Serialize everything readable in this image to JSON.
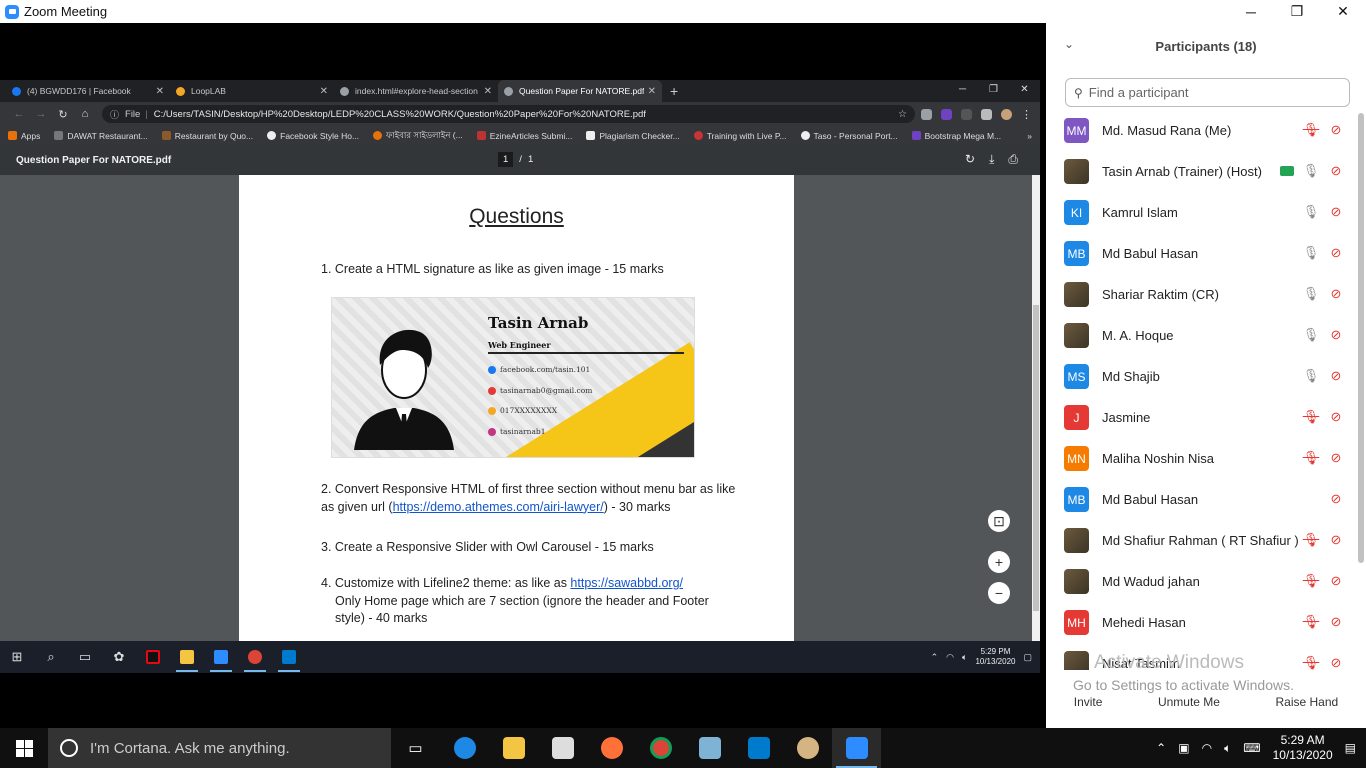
{
  "zoom": {
    "title": "Zoom Meeting",
    "controls": {
      "minimize": "─",
      "restore": "❐",
      "close": "✕"
    }
  },
  "chrome": {
    "tabs": [
      {
        "label": "(4) BGWDD176 | Facebook",
        "color": "#1877f2"
      },
      {
        "label": "LoopLAB",
        "color": "#f5a623"
      },
      {
        "label": "index.html#explore-head-section",
        "color": "#9aa0a6"
      },
      {
        "label": "Question Paper For NATORE.pdf",
        "color": "#9aa0a6"
      }
    ],
    "new_tab": "+",
    "address": {
      "prefix": "File",
      "url": "C:/Users/TASIN/Desktop/HP%20Desktop/LEDP%20CLASS%20WORK/Question%20Paper%20For%20NATORE.pdf"
    },
    "bookmarks": [
      {
        "label": "Apps",
        "color": "#e8710a"
      },
      {
        "label": "DAWAT Restaurant...",
        "color": "#777"
      },
      {
        "label": "Restaurant by Quo...",
        "color": "#8a5a2b"
      },
      {
        "label": "Facebook Style Ho...",
        "color": "#eee"
      },
      {
        "label": "ফাইবার সাইডলাইন (...",
        "color": "#e8710a"
      },
      {
        "label": "EzineArticles Submi...",
        "color": "#b33"
      },
      {
        "label": "Plagiarism Checker...",
        "color": "#eee"
      },
      {
        "label": "Training with Live P...",
        "color": "#c33"
      },
      {
        "label": "Taso - Personal Port...",
        "color": "#eee"
      },
      {
        "label": "Bootstrap Mega M...",
        "color": "#6f42c1"
      }
    ],
    "bookmarks_more": "»"
  },
  "pdf": {
    "title": "Question Paper For NATORE.pdf",
    "page_current": "1",
    "page_sep": "/",
    "page_total": "1",
    "heading": "Questions",
    "q1": "1.   Create a HTML signature as like as given image - 15 marks",
    "q2_a": "2.   Convert  Responsive HTML of first three section without menu bar as like as given url (",
    "q2_link": "https://demo.athemes.com/airi-lawyer/",
    "q2_b": ") - 30 marks",
    "q3": "3.   Create a Responsive Slider with Owl Carousel - 15 marks",
    "q4_a": "4.  Customize with Lifeline2 theme: as like as ",
    "q4_link": "https://sawabbd.org/",
    "q4_b": "Only Home page which are 7 section (ignore the header and Footer style) - 40 marks",
    "signature": {
      "name": "Tasin Arnab",
      "role": "Web Engineer",
      "facebook": "facebook.com/tasin.101",
      "email": "tasinarnab0@gmail.com",
      "phone": "017XXXXXXXX",
      "instagram": "tasinarnab1"
    }
  },
  "inner_clock": {
    "time": "5:29 PM",
    "date": "10/13/2020"
  },
  "participants": {
    "title": "Participants (18)",
    "search_placeholder": "Find a participant",
    "list": [
      {
        "name": "Md. Masud Rana (Me)",
        "initials": "MM",
        "color": "#7e57c2",
        "mic": "muted",
        "photo": false,
        "sharing": false
      },
      {
        "name": "Tasin Arnab (Trainer) (Host)",
        "initials": "",
        "color": "#555",
        "mic": "on",
        "photo": true,
        "sharing": true
      },
      {
        "name": "Kamrul Islam",
        "initials": "KI",
        "color": "#1e88e5",
        "mic": "on",
        "photo": false,
        "sharing": false
      },
      {
        "name": "Md Babul Hasan",
        "initials": "MB",
        "color": "#1e88e5",
        "mic": "on",
        "photo": false,
        "sharing": false
      },
      {
        "name": "Shariar Raktim (CR)",
        "initials": "",
        "color": "#555",
        "mic": "on",
        "photo": true,
        "sharing": false
      },
      {
        "name": "M. A. Hoque",
        "initials": "",
        "color": "#555",
        "mic": "on",
        "photo": true,
        "sharing": false
      },
      {
        "name": "Md Shajib",
        "initials": "MS",
        "color": "#1e88e5",
        "mic": "on",
        "photo": false,
        "sharing": false
      },
      {
        "name": "Jasmine",
        "initials": "J",
        "color": "#e53935",
        "mic": "muted",
        "photo": false,
        "sharing": false
      },
      {
        "name": "Maliha Noshin Nisa",
        "initials": "MN",
        "color": "#f57c00",
        "mic": "muted",
        "photo": false,
        "sharing": false
      },
      {
        "name": "Md Babul Hasan",
        "initials": "MB",
        "color": "#1e88e5",
        "mic": "none",
        "photo": false,
        "sharing": false
      },
      {
        "name": "Md Shafiur Rahman ( RT Shafiur )",
        "initials": "",
        "color": "#555",
        "mic": "muted",
        "photo": true,
        "sharing": false
      },
      {
        "name": "Md Wadud jahan",
        "initials": "",
        "color": "#555",
        "mic": "muted",
        "photo": true,
        "sharing": false
      },
      {
        "name": "Mehedi Hasan",
        "initials": "MH",
        "color": "#e53935",
        "mic": "muted",
        "photo": false,
        "sharing": false
      },
      {
        "name": "Nisat Tasmim",
        "initials": "",
        "color": "#555",
        "mic": "muted",
        "photo": true,
        "sharing": false
      }
    ],
    "footer": {
      "invite": "Invite",
      "unmute": "Unmute Me",
      "raise": "Raise Hand"
    }
  },
  "watermark": {
    "line1": "Activate Windows",
    "line2": "Go to Settings to activate Windows."
  },
  "taskbar": {
    "cortana": "I'm Cortana. Ask me anything.",
    "time": "5:29 AM",
    "date": "10/13/2020"
  }
}
